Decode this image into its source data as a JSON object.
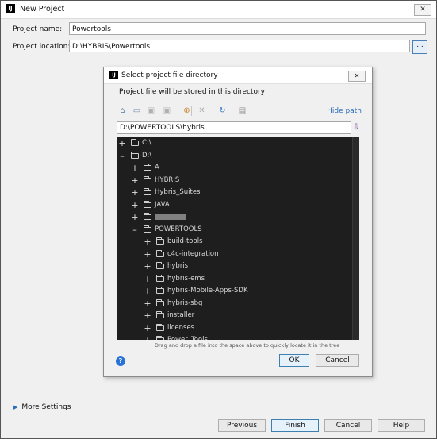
{
  "window": {
    "app_icon": "IJ",
    "title": "New Project",
    "close": "✕"
  },
  "form": {
    "name_label": "Project name:",
    "name_value": "Powertools",
    "location_label": "Project location:",
    "location_value": "D:\\HYBRIS\\Powertools",
    "browse_label": "..."
  },
  "dialog": {
    "icon": "IJ",
    "title": "Select project file directory",
    "close": "✕",
    "description": "Project file will be stored in this directory",
    "hide_path": "Hide path",
    "path_value": "D:\\POWERTOOLS\\hybris",
    "toolbar_icons": [
      "home-icon",
      "desktop-icon",
      "project-icon",
      "module-icon",
      "new-folder-icon",
      "delete-icon",
      "refresh-icon",
      "show-hidden-icon"
    ],
    "tree": [
      {
        "label": "C:\\",
        "expanded": false,
        "depth": 0
      },
      {
        "label": "D:\\",
        "expanded": true,
        "depth": 0
      },
      {
        "label": "A",
        "expanded": false,
        "depth": 1
      },
      {
        "label": "HYBRIS",
        "expanded": false,
        "depth": 1
      },
      {
        "label": "Hybris_Suites",
        "expanded": false,
        "depth": 1
      },
      {
        "label": "JAVA",
        "expanded": false,
        "depth": 1
      },
      {
        "label": "",
        "expanded": false,
        "depth": 1,
        "redacted": true
      },
      {
        "label": "POWERTOOLS",
        "expanded": true,
        "depth": 1
      },
      {
        "label": "build-tools",
        "expanded": false,
        "depth": 2
      },
      {
        "label": "c4c-integration",
        "expanded": false,
        "depth": 2
      },
      {
        "label": "hybris",
        "expanded": false,
        "depth": 2
      },
      {
        "label": "hybris-ems",
        "expanded": false,
        "depth": 2
      },
      {
        "label": "hybris-Mobile-Apps-SDK",
        "expanded": false,
        "depth": 2
      },
      {
        "label": "hybris-sbg",
        "expanded": false,
        "depth": 2
      },
      {
        "label": "installer",
        "expanded": false,
        "depth": 2
      },
      {
        "label": "licenses",
        "expanded": false,
        "depth": 2
      },
      {
        "label": "Power_Tools",
        "expanded": false,
        "depth": 2
      }
    ],
    "drag_hint": "Drag and drop a file into the space above to quickly locate it in the tree",
    "help_icon": "?",
    "ok_label": "OK",
    "cancel_label": "Cancel"
  },
  "footer": {
    "more_settings": "More Settings",
    "previous": "Previous",
    "finish": "Finish",
    "cancel": "Cancel",
    "help": "Help"
  },
  "colors": {
    "tree_background": "#1e1e1e",
    "link": "#2a6ebb",
    "primary_button_border": "#3c7fb1"
  }
}
